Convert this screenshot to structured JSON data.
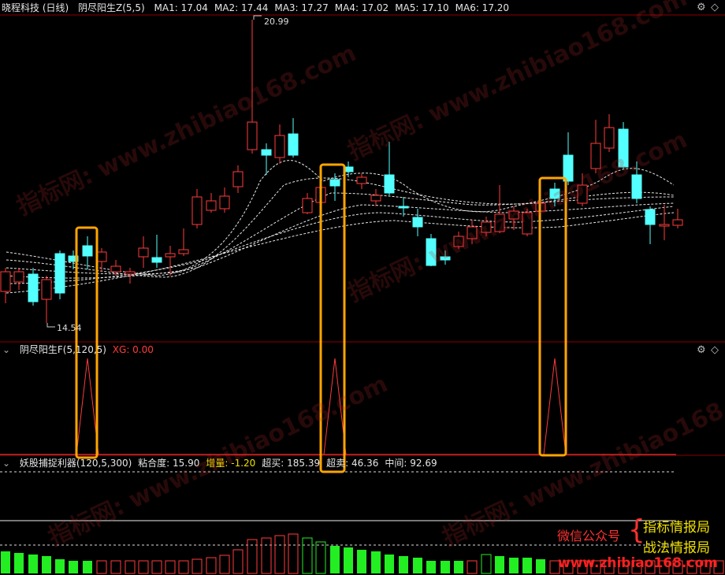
{
  "main_header": {
    "stock": "晓程科技 (日线)",
    "indicator": "阴尽阳生Z(5,5)",
    "ma": [
      {
        "label": "MA1: 17.04",
        "color": "#e6e6e6"
      },
      {
        "label": "MA2: 17.44",
        "color": "#e6e6e6"
      },
      {
        "label": "MA3: 17.27",
        "color": "#e6e6e6"
      },
      {
        "label": "MA4: 17.02",
        "color": "#e6e6e6"
      },
      {
        "label": "MA5: 17.10",
        "color": "#e6e6e6"
      },
      {
        "label": "MA6: 17.20",
        "color": "#e6e6e6"
      }
    ]
  },
  "price_annotations": {
    "high": "20.99",
    "low": "14.54"
  },
  "sub1_header": {
    "name": "阴尽阳生F(5,120,5)",
    "xg": "XG: 0.00"
  },
  "sub2_header": {
    "name": "妖股捕捉利器(120,5,300)",
    "items": [
      {
        "label": "粘合度: 15.90",
        "color": "#e6e6e6"
      },
      {
        "label": "增量: -1.20",
        "color": "#f0e000"
      },
      {
        "label": "超买: 185.39",
        "color": "#e6e6e6"
      },
      {
        "label": "超卖: 46.36",
        "color": "#e6e6e6"
      },
      {
        "label": "中间: 92.69",
        "color": "#e6e6e6"
      }
    ]
  },
  "promo": {
    "wechat": "微信公众号",
    "line1": "指标情报局",
    "line2": "战法情报局",
    "site": "www.zhibiao168.com"
  },
  "watermarks": [
    "指标网: www.zhibiao168.com",
    "指标网: www.zhibiao168.com",
    "指标网: www.zhibiao168.com",
    "指标网: www.zhibiao168.com",
    "指标网: www.zhibiao168.com"
  ],
  "controls": {
    "settings_icon": "gear-icon",
    "expand_icon": "diamond-icon",
    "collapse_icon": "chevron-down-icon"
  },
  "colors": {
    "up": "#ff3b3b",
    "down": "#54ffff",
    "highlight": "#ffa500",
    "divider": "#8b0000",
    "green_bar": "#22ee22",
    "red_bar": "#ff3b3b"
  }
}
